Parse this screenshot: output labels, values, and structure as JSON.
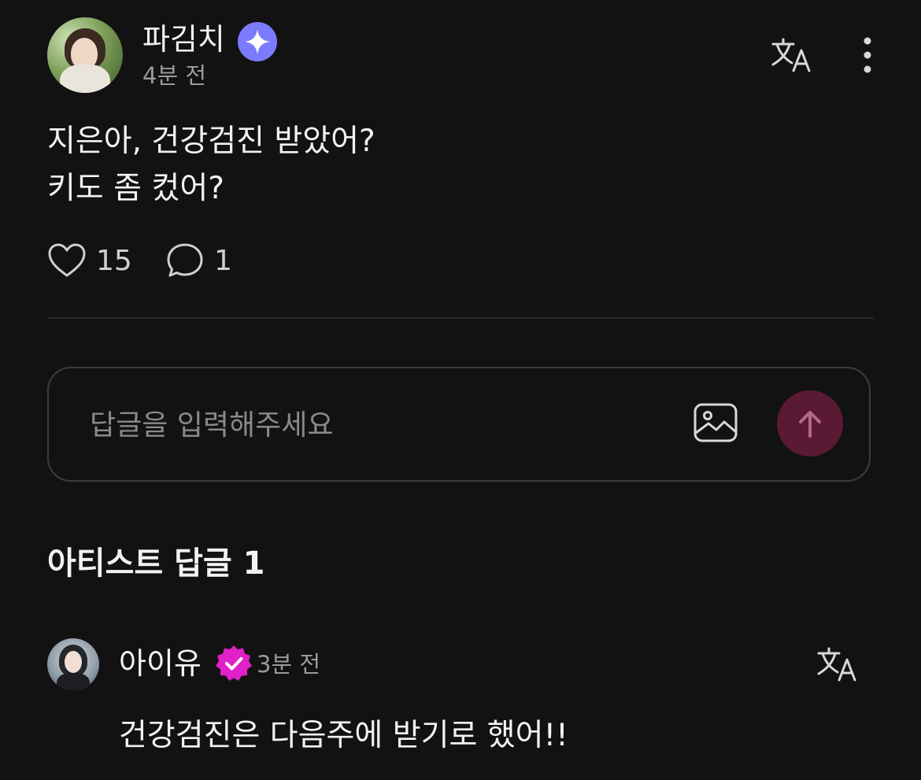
{
  "post": {
    "author_name": "파김치",
    "author_badge_icon": "sparkle-badge-icon",
    "time": "4분 전",
    "body_lines": [
      "지은아, 건강검진 받았어?",
      "키도 좀 컸어?"
    ],
    "likes": "15",
    "comments": "1"
  },
  "reply_input": {
    "placeholder": "답글을 입력해주세요",
    "value": ""
  },
  "artist_replies": {
    "title": "아티스트 답글 1",
    "items": [
      {
        "name": "아이유",
        "badge_icon": "verified-badge-icon",
        "time": "3분 전",
        "text": "건강검진은 다음주에 받기로 했어!!"
      }
    ]
  },
  "colors": {
    "background": "#121212",
    "sparkle_badge": "#7a7bff",
    "verified_badge": "#e020c8",
    "send_button": "#5a1a33",
    "muted_text": "#9a9a9a"
  }
}
